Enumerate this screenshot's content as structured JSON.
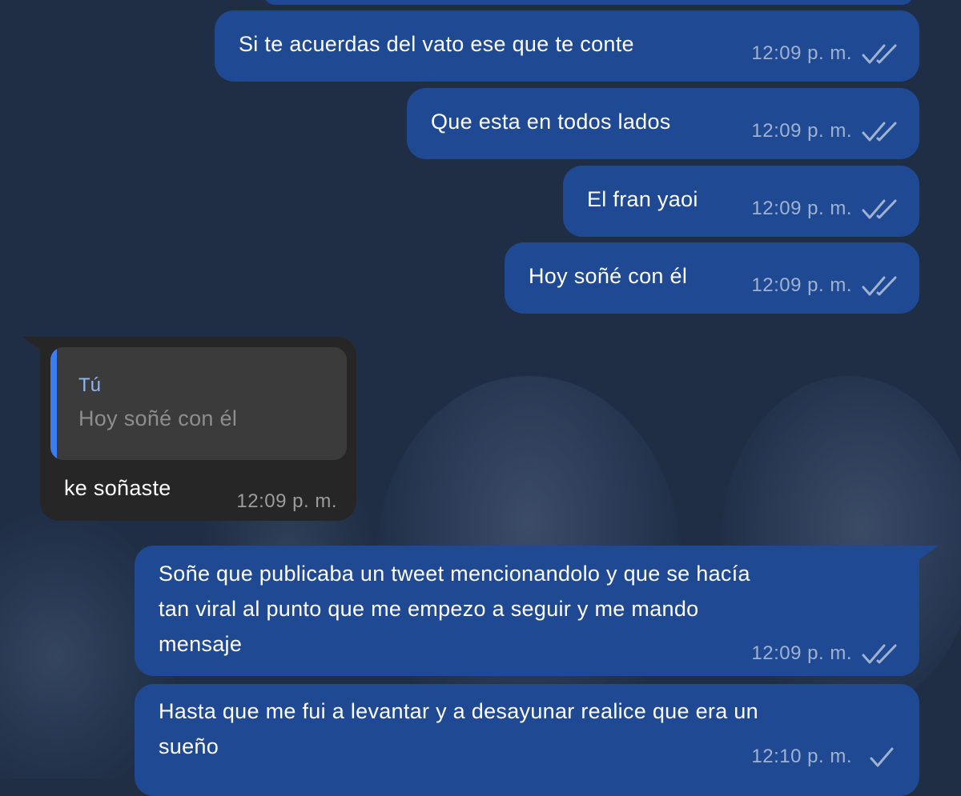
{
  "messages": [
    {
      "id": "m0",
      "direction": "out",
      "text": ""
    },
    {
      "id": "m1",
      "direction": "out",
      "text": "Si te acuerdas del vato ese que te conte",
      "time": "12:09 p. m.",
      "status": "read"
    },
    {
      "id": "m2",
      "direction": "out",
      "text": "Que esta en todos lados",
      "time": "12:09 p. m.",
      "status": "read"
    },
    {
      "id": "m3",
      "direction": "out",
      "text": "El fran yaoi",
      "time": "12:09 p. m.",
      "status": "read"
    },
    {
      "id": "m4",
      "direction": "out",
      "text": "Hoy soñé con él",
      "time": "12:09 p. m.",
      "status": "read"
    },
    {
      "id": "m5",
      "direction": "in",
      "reply_to": {
        "author": "Tú",
        "text": "Hoy soñé con él"
      },
      "text": "ke soñaste",
      "time": "12:09 p. m."
    },
    {
      "id": "m6",
      "direction": "out",
      "text": "Soñe que publicaba un tweet mencionandolo y que se hacía\ntan viral al punto que me empezo a seguir y me mando\nmensaje",
      "time": "12:09 p. m.",
      "status": "read"
    },
    {
      "id": "m7",
      "direction": "out",
      "text": "Hasta que me fui a levantar y a desayunar realice que era un\nsueño",
      "time": "12:10 p. m.",
      "status": "sent"
    }
  ],
  "icons": {
    "read": "double-check-icon",
    "sent": "single-check-icon"
  },
  "colors": {
    "background": "#1f2e45",
    "outgoing_bubble": "#1f4a93",
    "incoming_bubble": "#262626",
    "reply_accent": "#3a7ef5",
    "timestamp": "#9fb2d2"
  }
}
